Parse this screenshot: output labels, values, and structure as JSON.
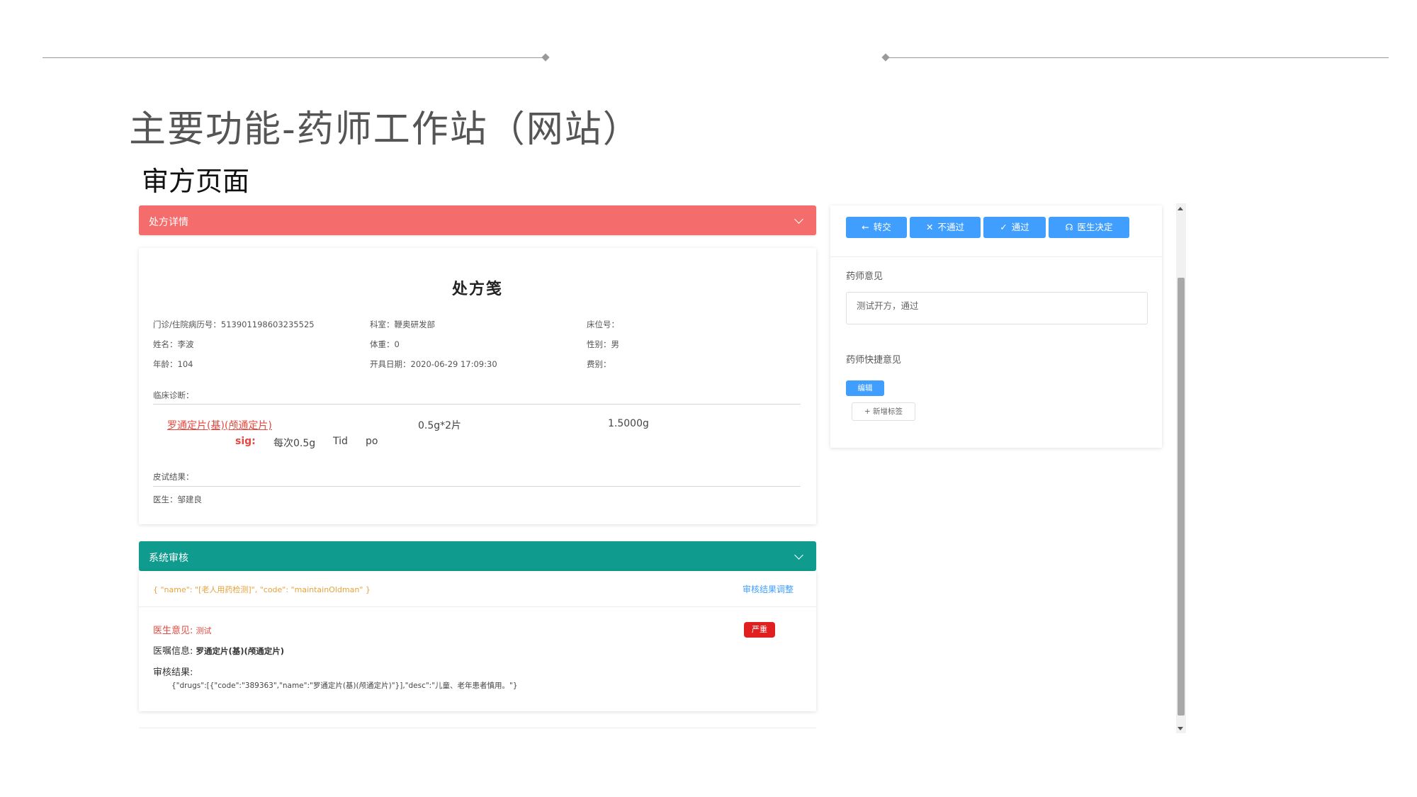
{
  "slide": {
    "title": "主要功能-药师工作站（网站）",
    "subtitle": "审方页面"
  },
  "prescription_panel": {
    "header": "处方详情",
    "title": "处方笺",
    "fields": {
      "record_no": "门诊/住院病历号：513901198603235525",
      "department": "科室：鞭奥研发部",
      "bed": "床位号：",
      "name": "姓名：李波",
      "weight": "体重：0",
      "gender": "性别：男",
      "age": "年龄：104",
      "date": "开具日期：2020-06-29 17:09:30",
      "fee_type": "费别："
    },
    "diagnosis_label": "临床诊断：",
    "drug": {
      "name": "罗通定片(基)(颅通定片)",
      "spec": "0.5g*2片",
      "total": "1.5000g",
      "sig_label": "sig:",
      "dose": "每次0.5g",
      "freq": "Tid",
      "route": "po"
    },
    "skin_test_label": "皮试结果：",
    "doctor": "医生：邹建良"
  },
  "system_review_panel": {
    "header": "系统审核",
    "json_text": "{ \"name\": \"[老人用药检测]\", \"code\": \"maintainOldman\" }",
    "adjust_link": "审核结果调整",
    "doctor_opinion_label": "医生意见:",
    "doctor_opinion_value": "测试",
    "severity_badge": "严重",
    "order_info_label": "医嘱信息:",
    "order_info_value": "罗通定片(基)(颅通定片)",
    "result_label": "审核结果:",
    "result_text": "{\"drugs\":[{\"code\":\"389363\",\"name\":\"罗通定片(基)(颅通定片)\"}],\"desc\":\"儿童、老年患者慎用。\"}"
  },
  "actions": {
    "transfer": "转交",
    "reject": "不通过",
    "approve": "通过",
    "doctor_decide": "医生决定"
  },
  "pharmacist": {
    "opinion_label": "药师意见",
    "opinion_value": "测试开方，通过",
    "quick_label": "药师快捷意见",
    "edit_button": "编辑",
    "add_tag_button": "+ 新增标签"
  },
  "colors": {
    "prescription_header": "#f56c6c",
    "review_header": "#0f9b8e",
    "primary_button": "#409eff",
    "danger_text": "#e5473e",
    "badge_red": "#e02020"
  }
}
